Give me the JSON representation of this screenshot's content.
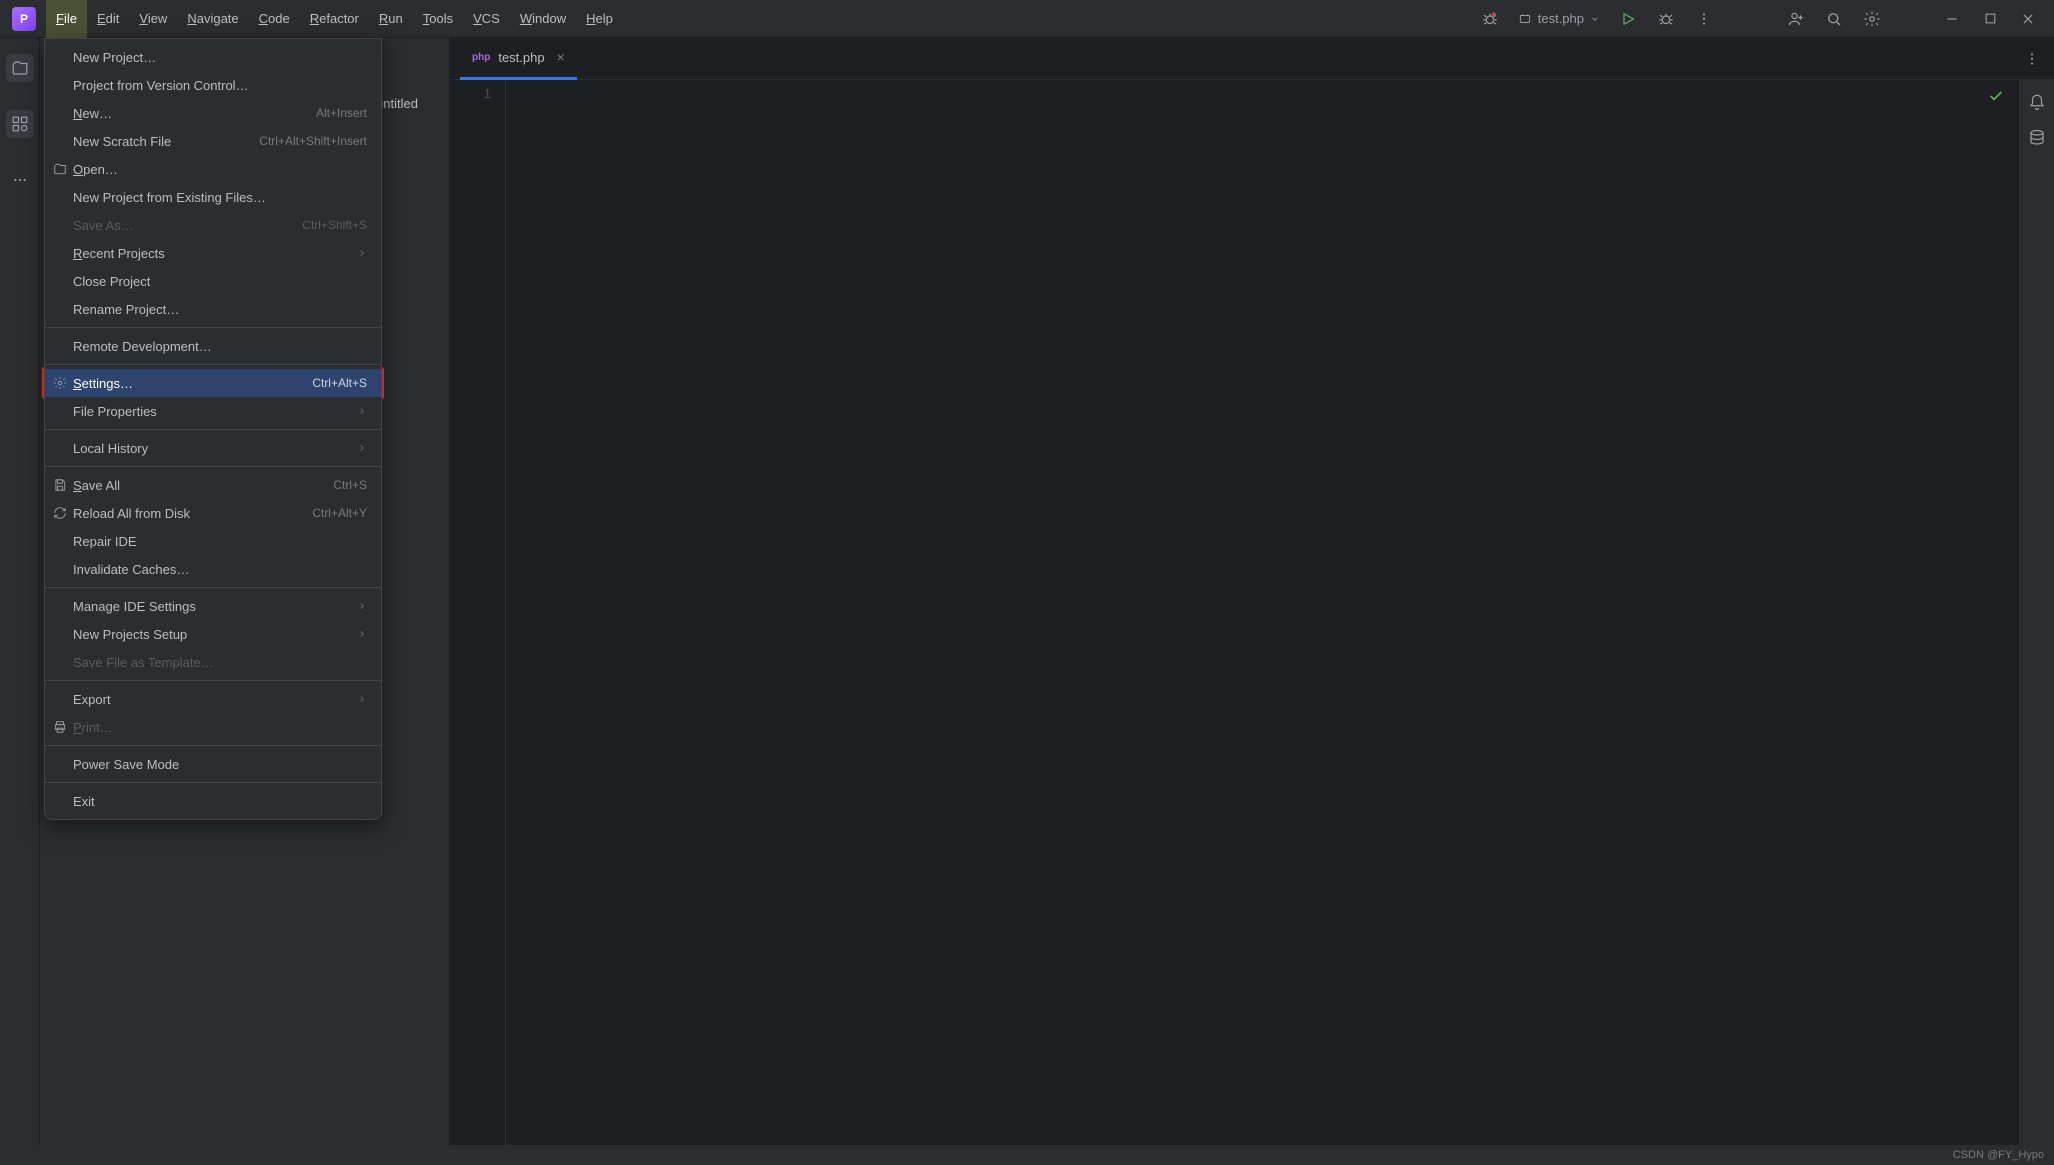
{
  "menubar": {
    "items": [
      "File",
      "Edit",
      "View",
      "Navigate",
      "Code",
      "Refactor",
      "Run",
      "Tools",
      "VCS",
      "Window",
      "Help"
    ],
    "active_index": 0
  },
  "run_config": {
    "label": "test.php"
  },
  "breadcrumb": {
    "visible_tail": "untitled"
  },
  "tab": {
    "filename": "test.php",
    "lang_badge": "php"
  },
  "gutter": {
    "line1": "1"
  },
  "status": {
    "watermark": "CSDN @FY_Hypo"
  },
  "dropdown": {
    "items": [
      {
        "label": "New Project…"
      },
      {
        "label": "Project from Version Control…"
      },
      {
        "label": "New…",
        "shortcut": "Alt+Insert",
        "u": true
      },
      {
        "label": "New Scratch File",
        "shortcut": "Ctrl+Alt+Shift+Insert"
      },
      {
        "label": "Open…",
        "icon": "folder",
        "u": true
      },
      {
        "label": "New Project from Existing Files…"
      },
      {
        "label": "Save As…",
        "shortcut": "Ctrl+Shift+S",
        "disabled": true
      },
      {
        "label": "Recent Projects",
        "submenu": true,
        "u": true
      },
      {
        "label": "Close Project"
      },
      {
        "label": "Rename Project…"
      },
      {
        "sep": true
      },
      {
        "label": "Remote Development…"
      },
      {
        "sep": true
      },
      {
        "label": "Settings…",
        "shortcut": "Ctrl+Alt+S",
        "icon": "gear",
        "highlight": true,
        "u": true
      },
      {
        "label": "File Properties",
        "submenu": true
      },
      {
        "sep": true
      },
      {
        "label": "Local History",
        "submenu": true
      },
      {
        "sep": true
      },
      {
        "label": "Save All",
        "shortcut": "Ctrl+S",
        "icon": "save",
        "u": true
      },
      {
        "label": "Reload All from Disk",
        "shortcut": "Ctrl+Alt+Y",
        "icon": "reload"
      },
      {
        "label": "Repair IDE"
      },
      {
        "label": "Invalidate Caches…"
      },
      {
        "sep": true
      },
      {
        "label": "Manage IDE Settings",
        "submenu": true
      },
      {
        "label": "New Projects Setup",
        "submenu": true
      },
      {
        "label": "Save File as Template…",
        "disabled": true
      },
      {
        "sep": true
      },
      {
        "label": "Export",
        "submenu": true
      },
      {
        "label": "Print…",
        "icon": "print",
        "disabled": true,
        "u": true
      },
      {
        "sep": true
      },
      {
        "label": "Power Save Mode"
      },
      {
        "sep": true
      },
      {
        "label": "Exit"
      }
    ]
  },
  "icons": {
    "bug": "bug-icon",
    "user": "user-icon",
    "search": "search-icon",
    "settings": "settings-icon",
    "minimize": "minimize-icon",
    "maximize": "maximize-icon",
    "close": "close-icon",
    "run": "run-icon",
    "debug": "debug-icon",
    "more": "more-icon"
  }
}
